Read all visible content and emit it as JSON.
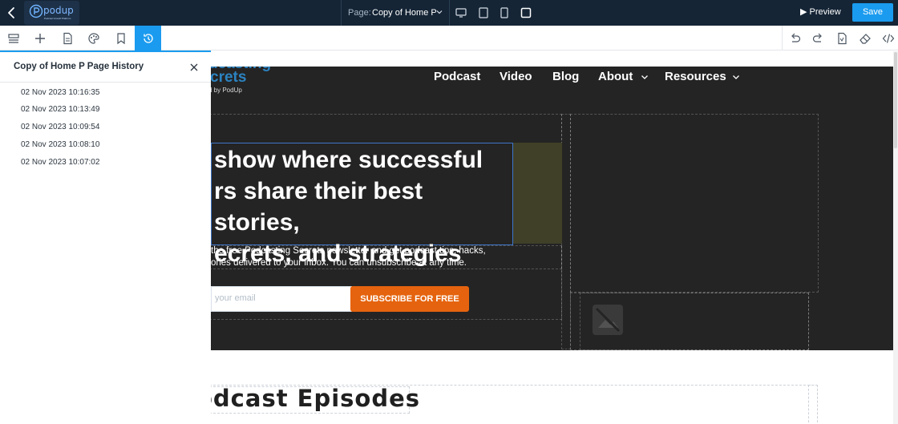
{
  "topbar": {
    "logo": {
      "text": "podup",
      "subtext": "Podcast Growth Platform"
    },
    "page_selector": {
      "label": "Page:",
      "value": "Copy of Home P"
    },
    "devices": [
      "desktop-icon",
      "tablet-landscape-icon",
      "tablet-icon",
      "mobile-icon"
    ],
    "preview_label": "Preview",
    "save_label": "Save"
  },
  "toolbar": {
    "left_tools": [
      "layers-icon",
      "add-icon",
      "page-icon",
      "theme-icon",
      "bookmark-icon",
      "history-icon"
    ],
    "right_tools": [
      "undo-icon",
      "redo-icon",
      "pdf-icon",
      "eraser-icon",
      "code-icon"
    ],
    "active_tool": "history-icon"
  },
  "history_panel": {
    "title": "Copy of Home P Page History",
    "items": [
      "02 Nov 2023 10:16:35",
      "02 Nov 2023 10:13:49",
      "02 Nov 2023 10:09:54",
      "02 Nov 2023 10:08:10",
      "02 Nov 2023 10:07:02"
    ]
  },
  "site": {
    "brand": {
      "line1": "dcasting",
      "line2": "crets",
      "byline": "d by PodUp"
    },
    "nav": [
      "Podcast",
      "Video",
      "Blog",
      "About",
      "Resources"
    ],
    "hero": {
      "headline_lines": [
        "show where successful",
        "rs share their best stories,",
        "ecrets, and strategies"
      ],
      "subtext_lines": [
        "the free Podcasting Secrets newsletter and get podcast tips, hacks,",
        "ories delivered to your inbox. You can unsubscribe at any time."
      ],
      "email_placeholder": "your email",
      "subscribe_label": "SUBSCRIBE FOR FREE"
    },
    "episodes_title": "odcast Episodes"
  },
  "colors": {
    "topbar": "#152536",
    "accent": "#1a9bef",
    "hero_bg": "#242424",
    "subscribe": "#e5630e",
    "olive_block": "#404029"
  }
}
